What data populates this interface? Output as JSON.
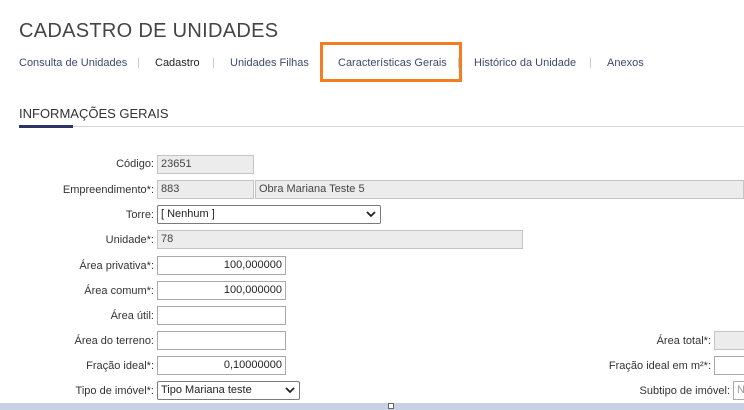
{
  "page": {
    "title": "CADASTRO DE UNIDADES"
  },
  "tabs": [
    {
      "label": "Consulta de Unidades"
    },
    {
      "label": "Cadastro"
    },
    {
      "label": "Unidades Filhas"
    },
    {
      "label": "Características Gerais"
    },
    {
      "label": "Histórico da Unidade"
    },
    {
      "label": "Anexos"
    }
  ],
  "highlight": {
    "color": "#f47d1f",
    "tab": "Características Gerais"
  },
  "section": {
    "title": "INFORMAÇÕES GERAIS",
    "accent_color": "#2e3466"
  },
  "form": {
    "codigo": {
      "label": "Código:",
      "value": "23651"
    },
    "empreendimento": {
      "label": "Empreendimento*:",
      "code": "883",
      "name": "Obra Mariana Teste 5"
    },
    "torre": {
      "label": "Torre:",
      "value": "[ Nenhum ]"
    },
    "unidade": {
      "label": "Unidade*:",
      "value": "78"
    },
    "area_privativa": {
      "label": "Área privativa*:",
      "value": "100,000000"
    },
    "area_comum": {
      "label": "Área comum*:",
      "value": "100,000000"
    },
    "area_util": {
      "label": "Área útil:",
      "value": ""
    },
    "area_terreno": {
      "label": "Área do terreno:",
      "value": ""
    },
    "area_total": {
      "label": "Área total*:",
      "value": ""
    },
    "fracao_ideal": {
      "label": "Fração ideal*:",
      "value": "0,10000000"
    },
    "fracao_ideal_m2": {
      "label": "Fração ideal em m²*:",
      "value": ""
    },
    "tipo_imovel": {
      "label": "Tipo de imóvel*:",
      "value": "Tipo Mariana teste"
    },
    "subtipo_imovel": {
      "label": "Subtipo de imóvel:",
      "value": "N"
    }
  }
}
